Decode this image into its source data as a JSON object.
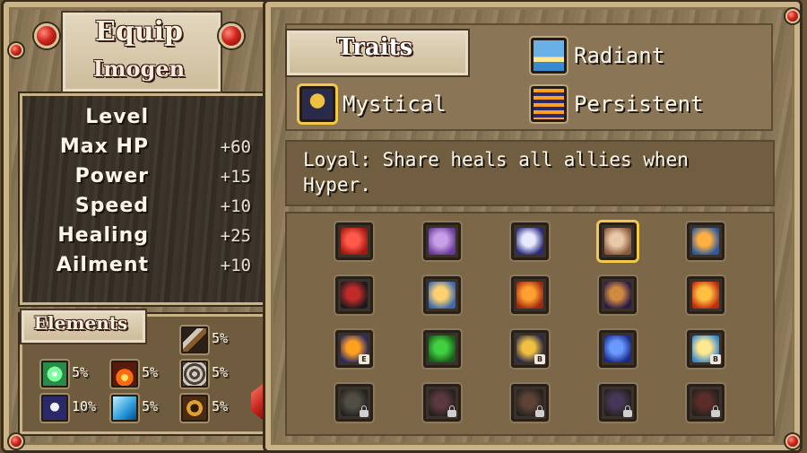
{
  "equip": {
    "title": "Equip",
    "character_name": "Imogen",
    "stats": [
      {
        "name": "Level",
        "value": ""
      },
      {
        "name": "Max HP",
        "value": "+60"
      },
      {
        "name": "Power",
        "value": "+15"
      },
      {
        "name": "Speed",
        "value": "+10"
      },
      {
        "name": "Healing",
        "value": "+25"
      },
      {
        "name": "Ailment",
        "value": "+10"
      }
    ]
  },
  "elements": {
    "title": "Elements",
    "items": [
      {
        "icon": "sword-icon",
        "value": "5%"
      },
      {
        "icon": "light-burst-icon",
        "value": "5%"
      },
      {
        "icon": "fire-icon",
        "value": "5%"
      },
      {
        "icon": "wind-swirl-icon",
        "value": "5%"
      },
      {
        "icon": "skull-icon",
        "value": "10%"
      },
      {
        "icon": "ice-crystal-icon",
        "value": "5%"
      },
      {
        "icon": "spider-icon",
        "value": "5%"
      }
    ]
  },
  "traits": {
    "title": "Traits",
    "list": [
      {
        "name": "Mystical",
        "icon": "crown-shield-icon",
        "selected": true
      },
      {
        "name": "Radiant",
        "icon": "sunrise-icon",
        "selected": false
      },
      {
        "name": "Persistent",
        "icon": "book-arrow-icon",
        "selected": false
      }
    ]
  },
  "description": "Loyal: Share heals all allies when Hyper.",
  "grid": {
    "rows": [
      [
        {
          "icon": "red-orb-icon",
          "colors": [
            "#ff5a4a",
            "#a0180e"
          ],
          "badge": "",
          "locked": false,
          "selected": false
        },
        {
          "icon": "nun-portrait-icon",
          "colors": [
            "#c8a0e8",
            "#6a3a9a"
          ],
          "badge": "",
          "locked": false,
          "selected": false
        },
        {
          "icon": "star-burst-icon",
          "colors": [
            "#e8e8ff",
            "#2a2a7a"
          ],
          "badge": "",
          "locked": false,
          "selected": false
        },
        {
          "icon": "heart-hands-icon",
          "colors": [
            "#e8c8a8",
            "#8a5a3a"
          ],
          "badge": "",
          "locked": false,
          "selected": true
        },
        {
          "icon": "spark-cross-icon",
          "colors": [
            "#ffb040",
            "#2a5aa0"
          ],
          "badge": "",
          "locked": false,
          "selected": false
        }
      ],
      [
        {
          "icon": "dark-orb-icon",
          "colors": [
            "#c02a2a",
            "#1a1a1a"
          ],
          "badge": "",
          "locked": false,
          "selected": false
        },
        {
          "icon": "scales-icon",
          "colors": [
            "#ffd070",
            "#3a6ab0"
          ],
          "badge": "",
          "locked": false,
          "selected": false
        },
        {
          "icon": "flame-fist-icon",
          "colors": [
            "#ffa030",
            "#a02810"
          ],
          "badge": "",
          "locked": false,
          "selected": false
        },
        {
          "icon": "bat-icon",
          "colors": [
            "#d08a40",
            "#2a1a4a"
          ],
          "badge": "",
          "locked": false,
          "selected": false
        },
        {
          "icon": "explosion-icon",
          "colors": [
            "#ffc040",
            "#c02a10"
          ],
          "badge": "",
          "locked": false,
          "selected": false
        }
      ],
      [
        {
          "icon": "book-arrow-icon",
          "colors": [
            "#ffa020",
            "#2a2a6a"
          ],
          "badge": "E",
          "locked": false,
          "selected": false
        },
        {
          "icon": "green-dragon-icon",
          "colors": [
            "#40d040",
            "#1a5a1a"
          ],
          "badge": "",
          "locked": false,
          "selected": false
        },
        {
          "icon": "crown-shield-icon",
          "colors": [
            "#f0c040",
            "#2a2a4a"
          ],
          "badge": "B",
          "locked": false,
          "selected": false
        },
        {
          "icon": "blue-shield-icon",
          "colors": [
            "#6a9aff",
            "#1a2a8a"
          ],
          "badge": "",
          "locked": false,
          "selected": false
        },
        {
          "icon": "sunrise-icon",
          "colors": [
            "#ffe890",
            "#3a8ad0"
          ],
          "badge": "B",
          "locked": false,
          "selected": false
        }
      ],
      [
        {
          "icon": "locked-trait-icon",
          "colors": [
            "#5a5a50",
            "#1a1a18"
          ],
          "badge": "",
          "locked": true,
          "selected": false
        },
        {
          "icon": "locked-trait-icon",
          "colors": [
            "#6a3a4a",
            "#1a1a18"
          ],
          "badge": "",
          "locked": true,
          "selected": false
        },
        {
          "icon": "locked-trait-icon",
          "colors": [
            "#6a4a3a",
            "#1a1a18"
          ],
          "badge": "",
          "locked": true,
          "selected": false
        },
        {
          "icon": "locked-trait-icon",
          "colors": [
            "#4a3a6a",
            "#1a1a18"
          ],
          "badge": "",
          "locked": true,
          "selected": false
        },
        {
          "icon": "locked-trait-icon",
          "colors": [
            "#6a2a2a",
            "#1a1a18"
          ],
          "badge": "",
          "locked": true,
          "selected": false
        }
      ]
    ]
  },
  "colors": {
    "frame": "#c9b489",
    "gem": "#d0261c",
    "panel_dark": "#383128",
    "selection": "#f4c84a"
  }
}
